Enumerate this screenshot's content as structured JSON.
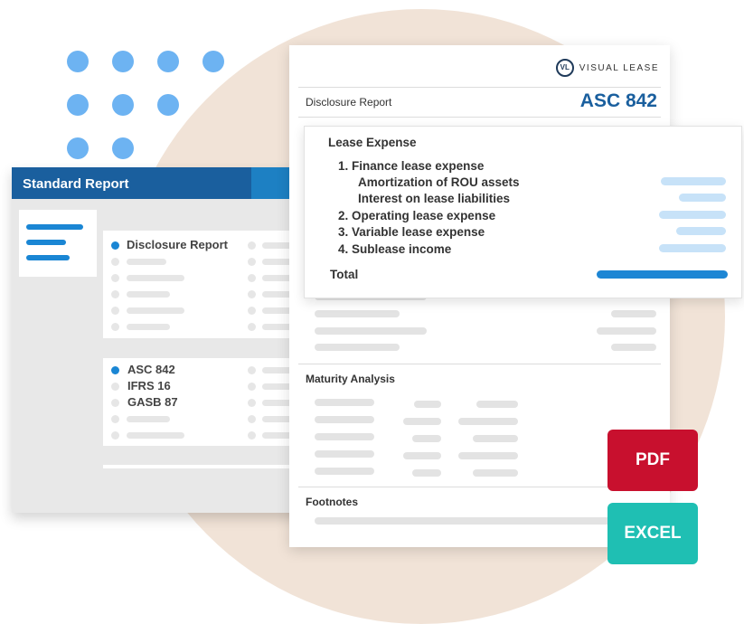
{
  "standard_report": {
    "title": "Standard Report",
    "group1": {
      "selected": "Disclosure Report"
    },
    "group2": {
      "options": [
        "ASC 842",
        "IFRS 16",
        "GASB 87"
      ]
    }
  },
  "disclosure": {
    "brand": "VISUAL LEASE",
    "brand_mark": "VL",
    "title": "Disclosure Report",
    "standard": "ASC 842",
    "maturity_title": "Maturity Analysis",
    "footnotes_title": "Footnotes"
  },
  "lease_expense": {
    "title": "Lease Expense",
    "items": [
      "1. Finance lease expense",
      "Amortization of ROU assets",
      "Interest on lease liabilities",
      "2. Operating lease expense",
      "3. Variable lease expense",
      "4. Sublease income"
    ],
    "total_label": "Total"
  },
  "export": {
    "pdf_label": "PDF",
    "excel_label": "EXCEL"
  },
  "colors": {
    "accent_blue": "#1a5f9e",
    "pdf_red": "#c8102e",
    "excel_teal": "#1fbfb3",
    "background_circle": "#f1e3d7"
  }
}
